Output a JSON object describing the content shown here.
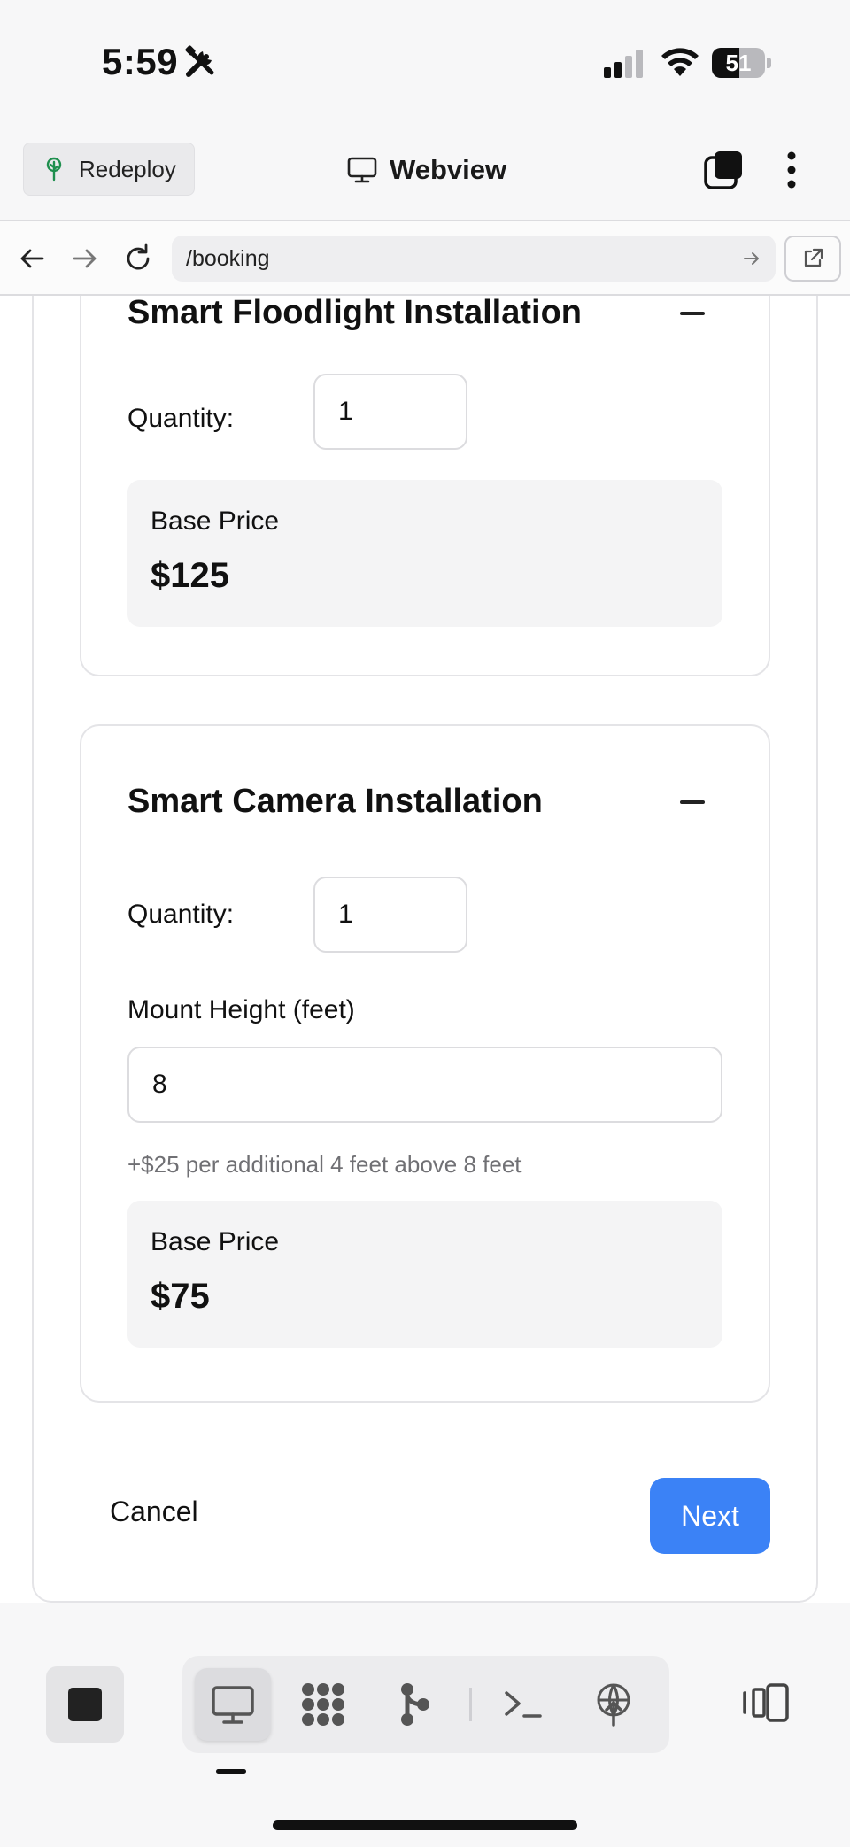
{
  "status_bar": {
    "time": "5:59",
    "battery": "51",
    "battery_level": 0.51
  },
  "header": {
    "redeploy_label": "Redeploy",
    "title": "Webview"
  },
  "browser": {
    "url": "/booking"
  },
  "services": [
    {
      "title": "Smart Floodlight Installation",
      "quantity_label": "Quantity:",
      "quantity": "1",
      "price_label": "Base Price",
      "price": "$125"
    },
    {
      "title": "Smart Camera Installation",
      "quantity_label": "Quantity:",
      "quantity": "1",
      "mount_label": "Mount Height (feet)",
      "mount_value": "8",
      "mount_hint": "+$25 per additional 4 feet above 8 feet",
      "price_label": "Base Price",
      "price": "$75"
    }
  ],
  "actions": {
    "cancel": "Cancel",
    "next": "Next"
  },
  "colors": {
    "primary": "#3b82f6",
    "card_border": "#e4e4e7",
    "price_bg": "#f4f4f5"
  },
  "toolbar": {
    "icons": [
      "stop-icon",
      "desktop-icon",
      "apps-icon",
      "branch-icon",
      "terminal-icon",
      "deploy-icon",
      "split-view-icon"
    ],
    "active": "desktop-icon"
  }
}
